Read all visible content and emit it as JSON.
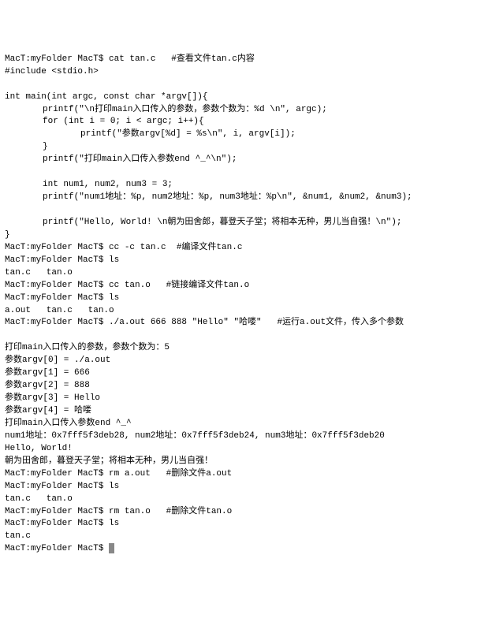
{
  "prompt": "MacT:myFolder MacT$ ",
  "lines": [
    {
      "c": "MacT:myFolder MacT$ cat tan.c   #查看文件tan.c内容"
    },
    {
      "c": "#include <stdio.h>"
    },
    {
      "c": " "
    },
    {
      "c": "int main(int argc, const char *argv[]){"
    },
    {
      "c": "printf(\"\\n打印main入口传入的参数，参数个数为：%d \\n\", argc);",
      "cls": "indent1"
    },
    {
      "c": "for (int i = 0; i < argc; i++){",
      "cls": "indent1"
    },
    {
      "c": "printf(\"参数argv[%d] = %s\\n\", i, argv[i]);",
      "cls": "indent2"
    },
    {
      "c": "}",
      "cls": "indent1"
    },
    {
      "c": "printf(\"打印main入口传入参数end ^_^\\n\");",
      "cls": "indent1"
    },
    {
      "c": " "
    },
    {
      "c": "int num1, num2, num3 = 3;",
      "cls": "indent1"
    },
    {
      "c": "printf(\"num1地址：%p, num2地址：%p, num3地址：%p\\n\", &num1, &num2, &num3);",
      "cls": "indent1"
    },
    {
      "c": " "
    },
    {
      "c": "printf(\"Hello, World! \\n朝为田舍郎，暮登天子堂；将相本无种，男儿当自强！\\n\");",
      "cls": "indent1"
    },
    {
      "c": "}"
    },
    {
      "c": "MacT:myFolder MacT$ cc -c tan.c  #编译文件tan.c"
    },
    {
      "c": "MacT:myFolder MacT$ ls"
    },
    {
      "c": "tan.c   tan.o"
    },
    {
      "c": "MacT:myFolder MacT$ cc tan.o   #链接编译文件tan.o"
    },
    {
      "c": "MacT:myFolder MacT$ ls"
    },
    {
      "c": "a.out   tan.c   tan.o"
    },
    {
      "c": "MacT:myFolder MacT$ ./a.out 666 888 \"Hello\" \"哈喽\"   #运行a.out文件，传入多个参数"
    },
    {
      "c": " "
    },
    {
      "c": "打印main入口传入的参数，参数个数为：5"
    },
    {
      "c": "参数argv[0] = ./a.out"
    },
    {
      "c": "参数argv[1] = 666"
    },
    {
      "c": "参数argv[2] = 888"
    },
    {
      "c": "参数argv[3] = Hello"
    },
    {
      "c": "参数argv[4] = 哈喽"
    },
    {
      "c": "打印main入口传入参数end ^_^"
    },
    {
      "c": "num1地址：0x7fff5f3deb28, num2地址：0x7fff5f3deb24, num3地址：0x7fff5f3deb20"
    },
    {
      "c": "Hello, World!"
    },
    {
      "c": "朝为田舍郎，暮登天子堂；将相本无种，男儿当自强！"
    },
    {
      "c": "MacT:myFolder MacT$ rm a.out   #删除文件a.out"
    },
    {
      "c": "MacT:myFolder MacT$ ls"
    },
    {
      "c": "tan.c   tan.o"
    },
    {
      "c": "MacT:myFolder MacT$ rm tan.o   #删除文件tan.o"
    },
    {
      "c": "MacT:myFolder MacT$ ls"
    },
    {
      "c": "tan.c"
    }
  ],
  "final_prompt": "MacT:myFolder MacT$ "
}
